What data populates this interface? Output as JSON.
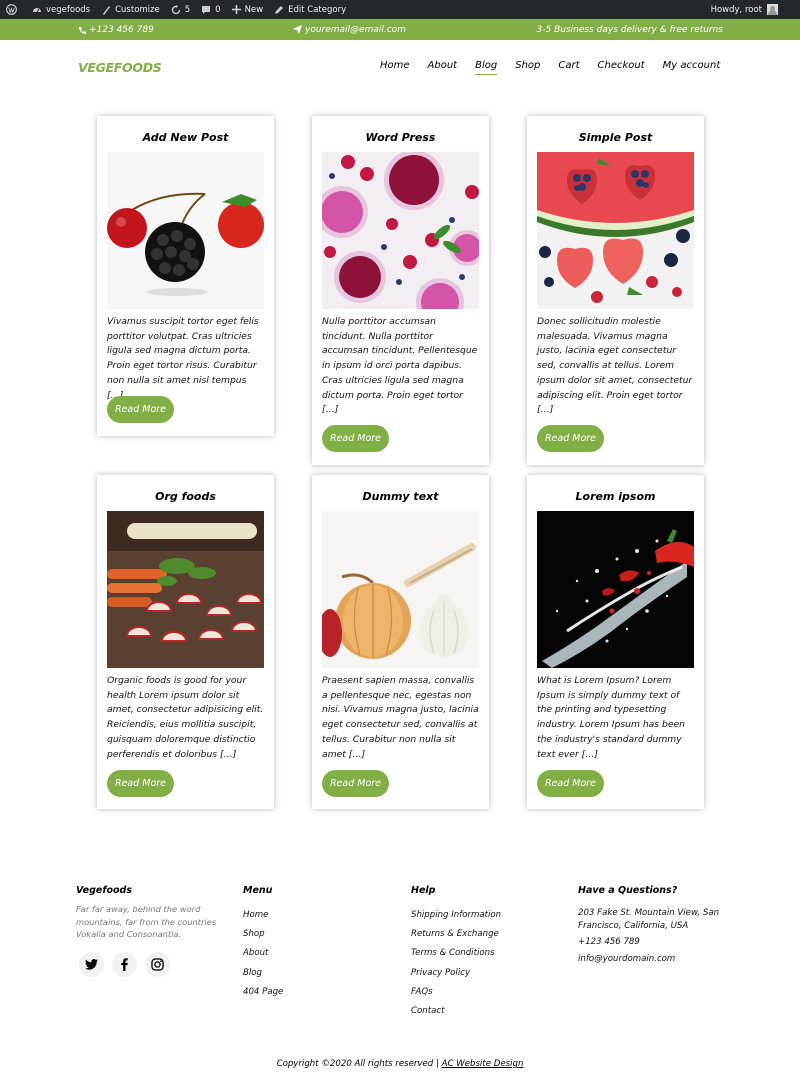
{
  "admin_bar": {
    "site_name": "vegefoods",
    "customize": "Customize",
    "updates_count": "5",
    "comments_count": "0",
    "new_label": "New",
    "edit_category": "Edit Category",
    "howdy": "Howdy, root"
  },
  "top_bar": {
    "phone": "+123 456 789",
    "email": "youremail@email.com",
    "delivery": "3-5 Business days delivery & free returns"
  },
  "header": {
    "logo": "VEGEFOODS",
    "menu": [
      "Home",
      "About",
      "Blog",
      "Shop",
      "Cart",
      "Checkout",
      "My account"
    ],
    "active_menu": "Blog"
  },
  "posts": [
    {
      "title": "Add New Post",
      "excerpt": "Vivamus suscipit tortor eget felis porttitor volutpat. Cras ultricies ligula sed magna dictum porta. Proin eget tortor risus. Curabitur non nulla sit amet nisl tempus […]",
      "button": "Read More",
      "image": "berries-and-cherry-photo"
    },
    {
      "title": "Word Press",
      "excerpt": "Nulla porttitor accumsan tincidunt. Nulla porttitor accumsan tincidunt. Pellentesque in ipsum id orci porta dapibus. Cras ultricies ligula sed magna dictum porta. Proin eget tortor […]",
      "button": "Read More",
      "image": "berry-smoothies-photo"
    },
    {
      "title": "Simple Post",
      "excerpt": "Donec sollicitudin molestie malesuada. Vivamus magna justo, lacinia eget consectetur sed, convallis at tellus. Lorem ipsum dolor sit amet, consectetur adipiscing elit. Proin eget tortor […]",
      "button": "Read More",
      "image": "watermelon-hearts-photo"
    },
    {
      "title": "Org foods",
      "excerpt": "Organic foods is good for your health Lorem ipsum dolor sit amet, consectetur adipisicing elit. Reiciendis, eius mollitia suscipit, quisquam doloremque distinctio perferendis et doloribus […]",
      "button": "Read More",
      "image": "vegetables-board-photo"
    },
    {
      "title": "Dummy text",
      "excerpt": "Praesent sapien massa, convallis a pellentesque nec, egestas non nisi. Vivamus magna justo, lacinia eget consectetur sed, convallis at tellus. Curabitur non nulla sit amet […]",
      "button": "Read More",
      "image": "onion-garlic-photo"
    },
    {
      "title": "Lorem ipsom",
      "excerpt": "What is Lorem Ipsum? Lorem Ipsum is simply dummy text of the printing and typesetting industry. Lorem Ipsum has been the industry's standard dummy text ever […]",
      "button": "Read More",
      "image": "pepper-splash-photo"
    }
  ],
  "footer": {
    "brand": {
      "title": "Vegefoods",
      "description": "Far far away, behind the word mountains, far from the countries Vokalia and Consonantia."
    },
    "menu": {
      "title": "Menu",
      "links": [
        "Home",
        "Shop",
        "About",
        "Blog",
        "404 Page"
      ]
    },
    "help": {
      "title": "Help",
      "links": [
        "Shipping Information",
        "Returns & Exchange",
        "Terms & Conditions",
        "Privacy Policy",
        "FAQs",
        "Contact"
      ]
    },
    "contact": {
      "title": "Have a Questions?",
      "address": "203 Fake St. Mountain View, San Francisco, California, USA",
      "phone": "+123 456 789",
      "email": "info@yourdomain.com"
    },
    "social": [
      "twitter-icon",
      "facebook-icon",
      "instagram-icon"
    ],
    "copyright": "Copyright ©2020 All rights reserved |",
    "copyright_link": "AC Website Design"
  },
  "colors": {
    "accent": "#82ae46",
    "admin_bar": "#23282d"
  }
}
